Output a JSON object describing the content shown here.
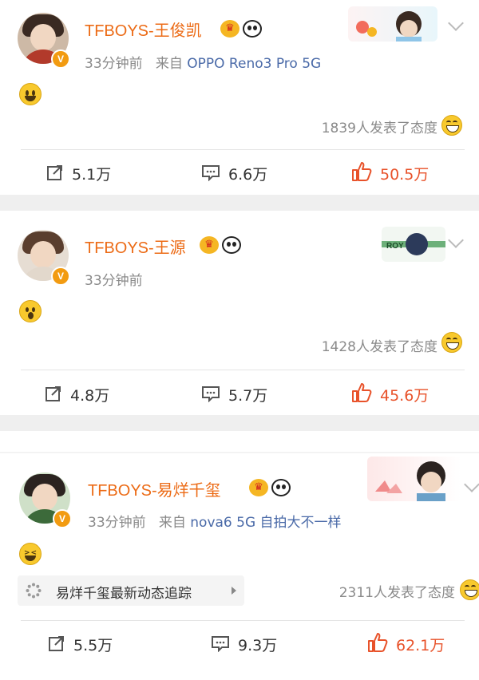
{
  "posts": [
    {
      "username": "TFBOYS-王俊凯",
      "time": "33分钟前",
      "source_prefix": "来自",
      "source": "OPPO Reno3 Pro 5G",
      "reaction_text": "1839人发表了态度",
      "repost_count": "5.1万",
      "comment_count": "6.6万",
      "like_count": "50.5万"
    },
    {
      "username": "TFBOYS-王源",
      "time": "33分钟前",
      "reaction_text": "1428人发表了态度",
      "repost_count": "4.8万",
      "comment_count": "5.7万",
      "like_count": "45.6万"
    },
    {
      "username": "TFBOYS-易烊千玺",
      "time": "33分钟前",
      "source_prefix": "来自",
      "source": "nova6 5G 自拍大不一样",
      "topic_tag": "易烊千玺最新动态追踪",
      "reaction_text": "2311人发表了态度",
      "repost_count": "5.5万",
      "comment_count": "9.3万",
      "like_count": "62.1万"
    }
  ],
  "colors": {
    "username": "#ec6b16",
    "like_active": "#e8522a",
    "source_link": "#4a6aa8",
    "separator": "#efefef"
  },
  "icons": [
    "crown-icon",
    "panda-icon",
    "verified-badge-icon",
    "repost-icon",
    "comment-icon",
    "like-icon",
    "chevron-down-icon"
  ]
}
